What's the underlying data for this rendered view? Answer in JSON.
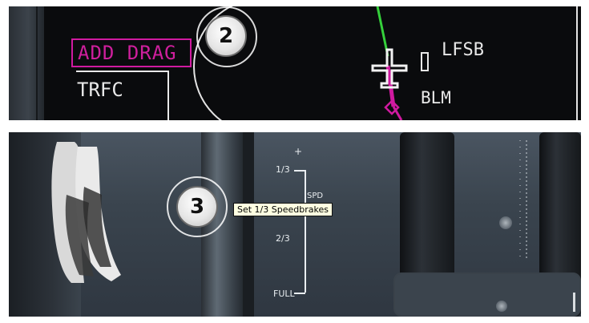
{
  "top_display": {
    "add_drag": "ADD DRAG",
    "trfc": "TRFC",
    "waypoint": "LFSB",
    "beacon": "BLM",
    "callout_number": "2"
  },
  "bottom_panel": {
    "callout_number": "3",
    "tooltip": "Set 1/3 Speedbrakes",
    "scale": {
      "plus": "+",
      "one_third": "1/3",
      "spd": "SPD",
      "two_thirds": "2/3",
      "full": "FULL"
    }
  },
  "colors": {
    "magenta": "#d01aa0",
    "display_white": "#e8e8e8",
    "green_track": "#35d13b"
  }
}
